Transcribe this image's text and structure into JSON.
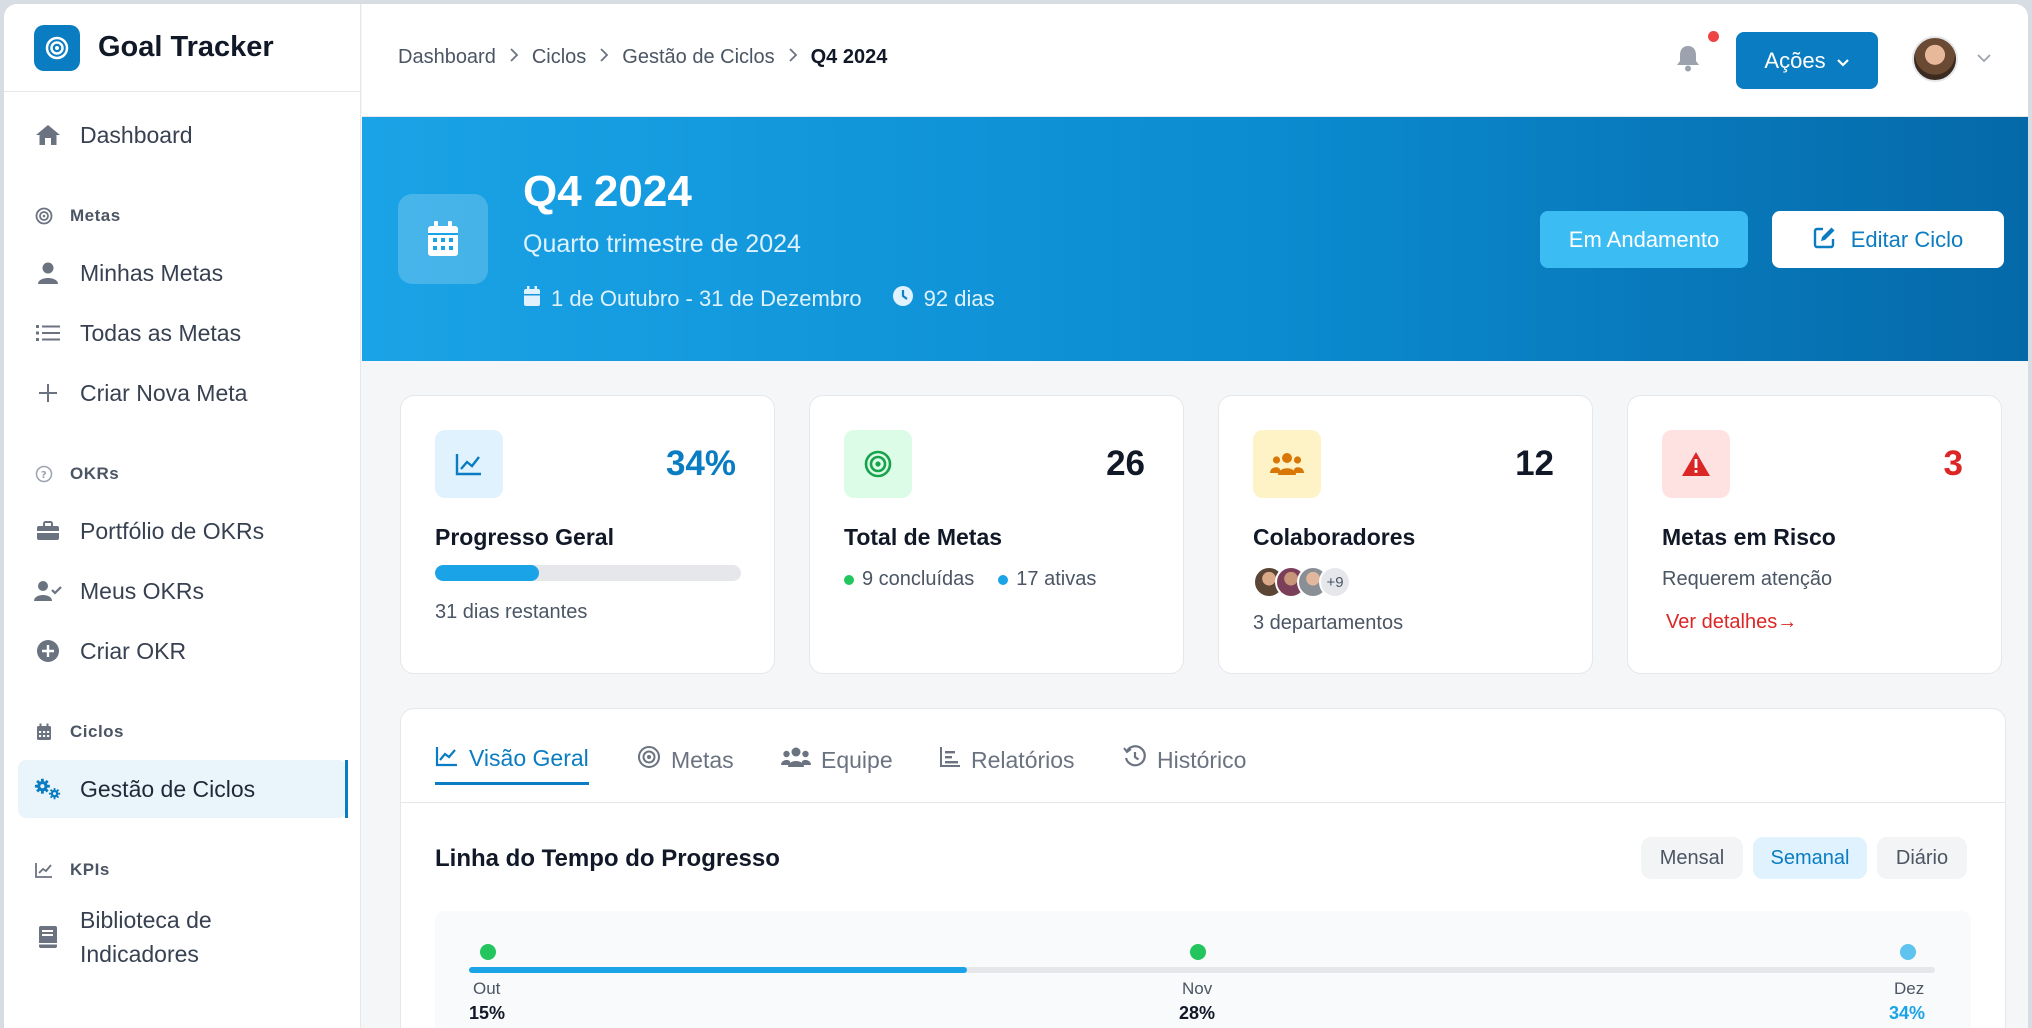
{
  "brand": {
    "name": "Goal Tracker"
  },
  "sidebar": {
    "dashboard": "Dashboard",
    "sections": [
      {
        "title": "Metas",
        "items": [
          "Minhas Metas",
          "Todas as Metas",
          "Criar Nova Meta"
        ]
      },
      {
        "title": "OKRs",
        "items": [
          "Portfólio de OKRs",
          "Meus OKRs",
          "Criar OKR"
        ]
      },
      {
        "title": "Ciclos",
        "items": [
          "Gestão de Ciclos"
        ]
      },
      {
        "title": "KPIs",
        "items": [
          "Biblioteca de Indicadores"
        ]
      }
    ]
  },
  "breadcrumb": [
    "Dashboard",
    "Ciclos",
    "Gestão de Ciclos",
    "Q4 2024"
  ],
  "topbar": {
    "actions_label": "Ações"
  },
  "hero": {
    "title": "Q4 2024",
    "subtitle": "Quarto trimestre de 2024",
    "date_range": "1 de Outubro - 31 de Dezembro",
    "duration": "92 dias",
    "status_label": "Em Andamento",
    "edit_label": "Editar Ciclo"
  },
  "cards": {
    "progress": {
      "value": "34%",
      "title": "Progresso Geral",
      "fraction": 0.34,
      "remaining": "31 dias restantes"
    },
    "goals": {
      "value": "26",
      "title": "Total de Metas",
      "completed": "9 concluídas",
      "active": "17 ativas"
    },
    "collaborators": {
      "value": "12",
      "title": "Colaboradores",
      "more": "+9",
      "departments": "3 departamentos"
    },
    "risk": {
      "value": "3",
      "title": "Metas em Risco",
      "note": "Requerem atenção",
      "link": "Ver detalhes→"
    }
  },
  "tabs": [
    "Visão Geral",
    "Metas",
    "Equipe",
    "Relatórios",
    "Histórico"
  ],
  "timeline": {
    "title": "Linha do Tempo do Progresso",
    "ranges": [
      "Mensal",
      "Semanal",
      "Diário"
    ],
    "selected_range": "Semanal",
    "progress_fraction": 0.34,
    "points": [
      {
        "label": "Out",
        "value": "15%",
        "status": "done"
      },
      {
        "label": "Nov",
        "value": "28%",
        "status": "done"
      },
      {
        "label": "Dez",
        "value": "34%",
        "status": "current"
      }
    ]
  },
  "colors": {
    "primary": "#0a7cc1",
    "hero_start": "#1aa3e6",
    "hero_end": "#0569a8",
    "success": "#22c55e",
    "danger": "#dc2626",
    "info": "#1aa3e6"
  }
}
